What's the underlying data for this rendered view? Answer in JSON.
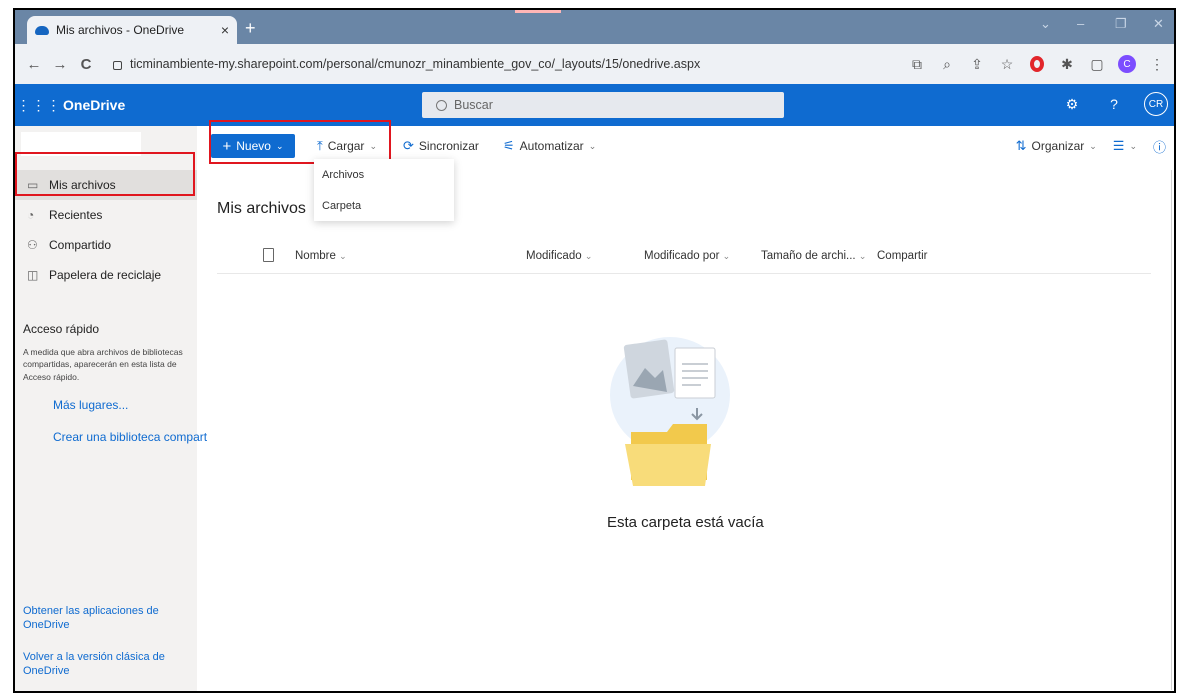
{
  "browser": {
    "tab_title": "Mis archivos - OneDrive",
    "tab_close": "×",
    "new_tab": "+",
    "url": "ticminambiente-my.sharepoint.com/personal/cmunozr_minambiente_gov_co/_layouts/15/onedrive.aspx",
    "window_controls": [
      "⌄",
      "–",
      "❐",
      "✕"
    ],
    "nav": {
      "back": "←",
      "forward": "→",
      "reload": "C"
    },
    "ext_avatar": "C"
  },
  "suite": {
    "app_name": "OneDrive",
    "search_placeholder": "Buscar",
    "help": "?",
    "user_initials": "CR"
  },
  "leftnav": {
    "items": [
      {
        "label": "Mis archivos",
        "icon": "folder-icon"
      },
      {
        "label": "Recientes",
        "icon": "clock-icon"
      },
      {
        "label": "Compartido",
        "icon": "share-icon"
      },
      {
        "label": "Papelera de reciclaje",
        "icon": "trash-icon"
      }
    ],
    "quick_access_title": "Acceso rápido",
    "quick_access_desc": "A medida que abra archivos de bibliotecas compartidas, aparecerán en esta lista de Acceso rápido.",
    "more_places": "Más lugares...",
    "create_library": "Crear una biblioteca compart",
    "get_apps": "Obtener las aplicaciones de OneDrive",
    "classic_version": "Volver a la versión clásica de OneDrive"
  },
  "commandbar": {
    "new_label": "Nuevo",
    "upload_label": "Cargar",
    "sync_label": "Sincronizar",
    "automate_label": "Automatizar",
    "sort_label": "Organizar"
  },
  "upload_menu": {
    "items": [
      "Archivos",
      "Carpeta"
    ]
  },
  "main": {
    "title": "Mis archivos",
    "columns": [
      "Nombre",
      "Modificado",
      "Modificado por",
      "Tamaño de archi...",
      "Compartir"
    ],
    "empty_message": "Esta carpeta está vacía"
  },
  "colors": {
    "suitebar": "#0f6bd0",
    "highlight": "#e0161f",
    "tabstrip": "#6a86a6"
  }
}
